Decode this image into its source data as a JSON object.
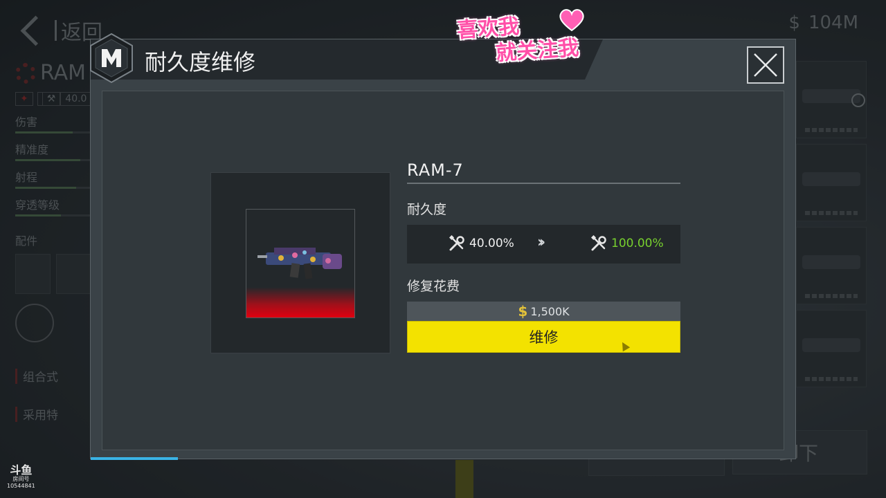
{
  "background": {
    "back_label": "返回",
    "currency_symbol": "$",
    "currency_amount": "104M",
    "weapon_name": "RAM",
    "weapon_tag_value": "40.0",
    "stats": [
      {
        "label": "伤害",
        "level": 0.75
      },
      {
        "label": "精准度",
        "level": 0.85
      },
      {
        "label": "射程",
        "level": 0.8
      },
      {
        "label": "穿透等级",
        "level": 0.6
      }
    ],
    "attachments_label": "配件",
    "row1_label": "组合式",
    "row2_label": "采用特",
    "right_button_label": "卸下"
  },
  "modal": {
    "title": "耐久度维修",
    "close_icon": "close-icon",
    "weapon": {
      "name": "RAM-7"
    },
    "durability": {
      "label": "耐久度",
      "current": "40.00%",
      "after": "100.00%",
      "current_color": "#f0f0f0",
      "after_color": "#78d12e"
    },
    "cost": {
      "label": "修复花费",
      "amount": "1,500K",
      "symbol": "$"
    },
    "repair_button_label": "维修"
  },
  "overlay": {
    "sticker_line1": "喜欢我",
    "sticker_line2": "就关注我",
    "watermark_logo": "斗鱼",
    "watermark_sub": "房间号",
    "watermark_room": "10544841"
  },
  "colors": {
    "repair_button": "#f3e200",
    "durability_up": "#78d12e",
    "progress_strip": "#3ab3e6"
  }
}
